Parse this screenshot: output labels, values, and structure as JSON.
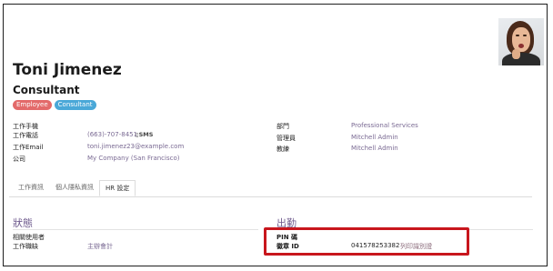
{
  "employee": {
    "name": "Toni Jimenez",
    "job_title": "Consultant",
    "tags": [
      "Employee",
      "Consultant"
    ]
  },
  "contact": {
    "mobile_label": "工作手機",
    "phone_label": "工作電話",
    "phone_value": "(663)-707-8451",
    "sms_label": "SMS",
    "email_label": "工作Email",
    "email_value": "toni.jimenez23@example.com",
    "company_label": "公司",
    "company_value": "My Company (San Francisco)"
  },
  "org": {
    "department_label": "部門",
    "department_value": "Professional Services",
    "manager_label": "管理員",
    "manager_value": "Mitchell Admin",
    "coach_label": "教練",
    "coach_value": "Mitchell Admin"
  },
  "tabs": [
    {
      "label": "工作資訊",
      "active": false
    },
    {
      "label": "個人隱私資訊",
      "active": false
    },
    {
      "label": "HR 設定",
      "active": true
    }
  ],
  "status_section": {
    "title": "狀態",
    "related_user_label": "相關使用者",
    "job_position_label": "工作職缺",
    "job_position_value": "主辦會計"
  },
  "attendance_section": {
    "title": "出勤",
    "pin_label": "PIN 碼",
    "badge_label": "徽章 ID",
    "badge_value": "041578253382",
    "print_badge_label": "列印識別證"
  },
  "colors": {
    "link": "#7a6a93",
    "section_title": "#6f5b8e",
    "tag_employee": "#e36a6a",
    "tag_consultant": "#4aa8d8",
    "highlight": "#c8161d"
  }
}
